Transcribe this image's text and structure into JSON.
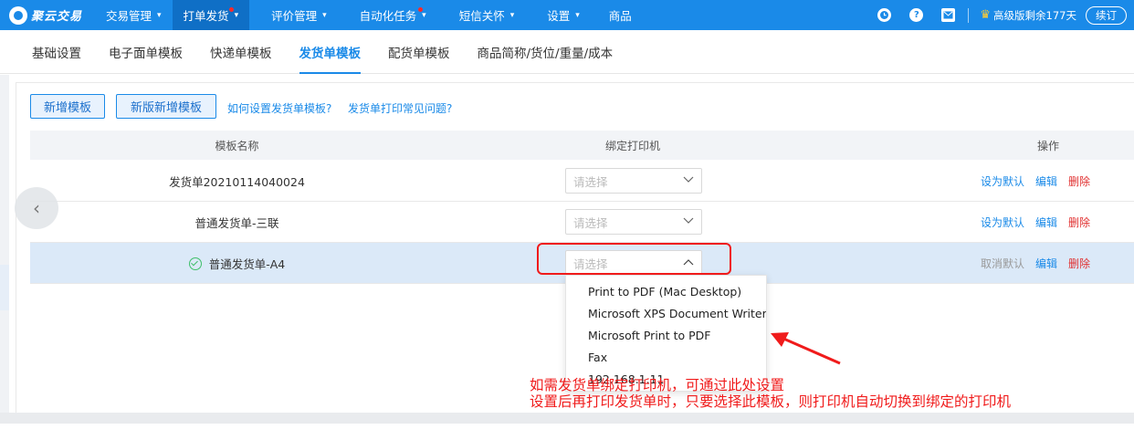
{
  "brand": {
    "name": "聚云交易"
  },
  "topnav": {
    "items": [
      {
        "label": "交易管理",
        "caret": "▾",
        "active": false,
        "dot": false
      },
      {
        "label": "打单发货",
        "caret": "▾",
        "active": true,
        "dot": true
      },
      {
        "label": "评价管理",
        "caret": "▾",
        "active": false,
        "dot": false
      },
      {
        "label": "自动化任务",
        "caret": "▾",
        "active": false,
        "dot": true
      },
      {
        "label": "短信关怀",
        "caret": "▾",
        "active": false,
        "dot": false
      },
      {
        "label": "设置",
        "caret": "▾",
        "active": false,
        "dot": false
      },
      {
        "label": "商品",
        "caret": "",
        "active": false,
        "dot": false
      }
    ],
    "right": {
      "clock_icon": "clock-icon",
      "help_glyph": "?",
      "message_icon": "message-icon",
      "plan_text": "高级版剩余177天",
      "renew_label": "续订"
    }
  },
  "subtabs": [
    {
      "label": "基础设置",
      "active": false
    },
    {
      "label": "电子面单模板",
      "active": false
    },
    {
      "label": "快递单模板",
      "active": false
    },
    {
      "label": "发货单模板",
      "active": true
    },
    {
      "label": "配货单模板",
      "active": false
    },
    {
      "label": "商品简称/货位/重量/成本",
      "active": false
    }
  ],
  "toolbar": {
    "add_template": "新增模板",
    "add_new_template": "新版新增模板",
    "help_link_1": "如何设置发货单模板?",
    "help_link_2": "发货单打印常见问题?"
  },
  "table": {
    "headers": {
      "name": "模板名称",
      "printer": "绑定打印机",
      "ops": "操作"
    },
    "rows": [
      {
        "name": "发货单20210114040024",
        "placeholder": "请选择",
        "default_action": "设为默认",
        "edit": "编辑",
        "delete": "删除",
        "is_default": false
      },
      {
        "name": "普通发货单-三联",
        "placeholder": "请选择",
        "default_action": "设为默认",
        "edit": "编辑",
        "delete": "删除",
        "is_default": false
      },
      {
        "name": "普通发货单-A4",
        "placeholder": "请选择",
        "default_action": "取消默认",
        "edit": "编辑",
        "delete": "删除",
        "is_default": true
      }
    ]
  },
  "dropdown": {
    "options": [
      "Print to PDF (Mac Desktop)",
      "Microsoft XPS Document Writer",
      "Microsoft Print to PDF",
      "Fax",
      "192.168.1.11"
    ]
  },
  "annotation": {
    "line1": "如需发货单绑定打印机，可通过此处设置",
    "line2": "设置后再打印发货单时，只要选择此模板，则打印机自动切换到绑定的打印机"
  },
  "colors": {
    "nav_bg": "#1a8ae8",
    "nav_active": "#0f6fc6",
    "accent": "#1a8ae8",
    "danger": "#e03030",
    "annotation": "#f01b1b",
    "selected_row": "#dbe9f8"
  }
}
